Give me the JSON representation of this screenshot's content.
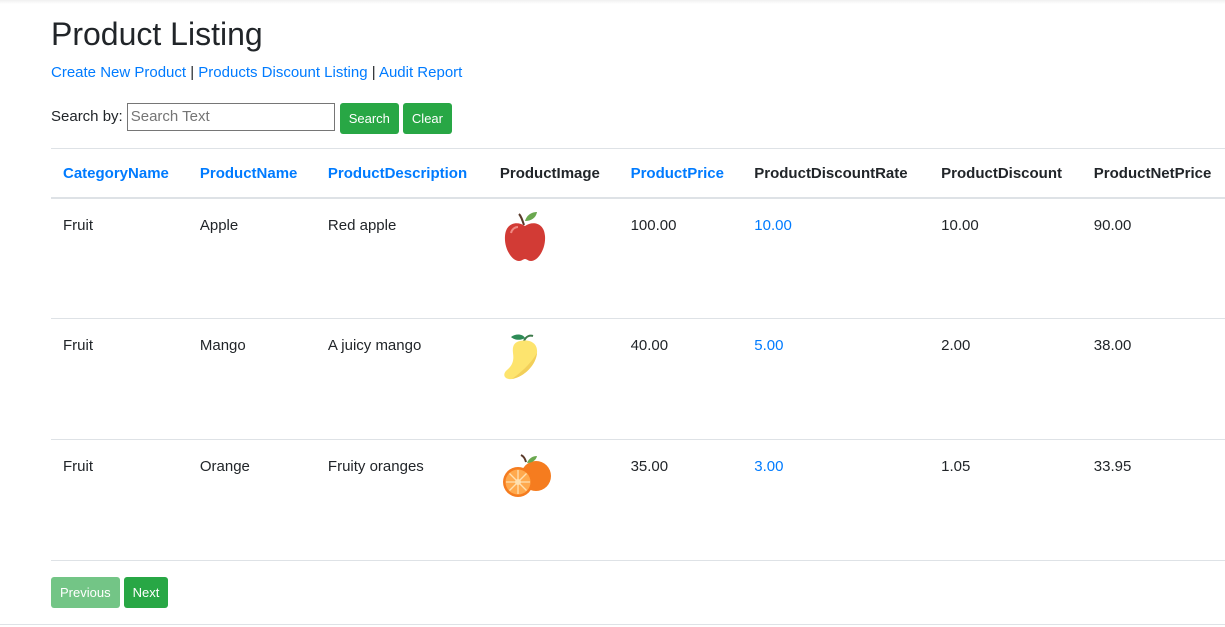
{
  "page": {
    "title": "Product Listing"
  },
  "nav": {
    "create": "Create New Product",
    "sep1": " | ",
    "discount": "Products Discount Listing",
    "sep2": " | ",
    "audit": "Audit Report"
  },
  "search": {
    "label": "Search by:",
    "placeholder": "Search Text",
    "value": "",
    "search_label": "Search",
    "clear_label": "Clear"
  },
  "table": {
    "headers": [
      {
        "label": "CategoryName",
        "sortable": true
      },
      {
        "label": "ProductName",
        "sortable": true
      },
      {
        "label": "ProductDescription",
        "sortable": true
      },
      {
        "label": "ProductImage",
        "sortable": false
      },
      {
        "label": "ProductPrice",
        "sortable": true
      },
      {
        "label": "ProductDiscountRate",
        "sortable": false
      },
      {
        "label": "ProductDiscount",
        "sortable": false
      },
      {
        "label": "ProductNetPrice",
        "sortable": false
      }
    ],
    "rows": [
      {
        "category": "Fruit",
        "name": "Apple",
        "description": "Red apple",
        "image": "apple-icon",
        "price": "100.00",
        "rate": "10.00",
        "discount": "10.00",
        "net": "90.00"
      },
      {
        "category": "Fruit",
        "name": "Mango",
        "description": "A juicy mango",
        "image": "mango-icon",
        "price": "40.00",
        "rate": "5.00",
        "discount": "2.00",
        "net": "38.00"
      },
      {
        "category": "Fruit",
        "name": "Orange",
        "description": "Fruity oranges",
        "image": "orange-icon",
        "price": "35.00",
        "rate": "3.00",
        "discount": "1.05",
        "net": "33.95"
      }
    ]
  },
  "pager": {
    "previous": "Previous",
    "next": "Next",
    "previous_disabled": true
  },
  "colors": {
    "link": "#007bff",
    "button": "#28a745",
    "button_disabled": "#73c586"
  }
}
